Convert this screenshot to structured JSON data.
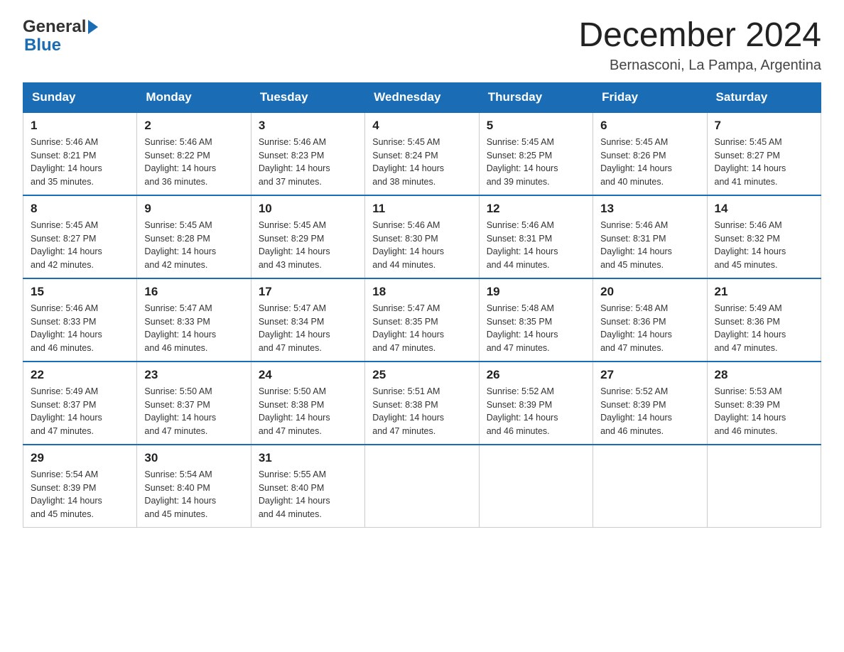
{
  "header": {
    "logo_general": "General",
    "logo_blue": "Blue",
    "title": "December 2024",
    "subtitle": "Bernasconi, La Pampa, Argentina"
  },
  "weekdays": [
    "Sunday",
    "Monday",
    "Tuesday",
    "Wednesday",
    "Thursday",
    "Friday",
    "Saturday"
  ],
  "weeks": [
    [
      {
        "day": "1",
        "sunrise": "5:46 AM",
        "sunset": "8:21 PM",
        "daylight": "14 hours and 35 minutes."
      },
      {
        "day": "2",
        "sunrise": "5:46 AM",
        "sunset": "8:22 PM",
        "daylight": "14 hours and 36 minutes."
      },
      {
        "day": "3",
        "sunrise": "5:46 AM",
        "sunset": "8:23 PM",
        "daylight": "14 hours and 37 minutes."
      },
      {
        "day": "4",
        "sunrise": "5:45 AM",
        "sunset": "8:24 PM",
        "daylight": "14 hours and 38 minutes."
      },
      {
        "day": "5",
        "sunrise": "5:45 AM",
        "sunset": "8:25 PM",
        "daylight": "14 hours and 39 minutes."
      },
      {
        "day": "6",
        "sunrise": "5:45 AM",
        "sunset": "8:26 PM",
        "daylight": "14 hours and 40 minutes."
      },
      {
        "day": "7",
        "sunrise": "5:45 AM",
        "sunset": "8:27 PM",
        "daylight": "14 hours and 41 minutes."
      }
    ],
    [
      {
        "day": "8",
        "sunrise": "5:45 AM",
        "sunset": "8:27 PM",
        "daylight": "14 hours and 42 minutes."
      },
      {
        "day": "9",
        "sunrise": "5:45 AM",
        "sunset": "8:28 PM",
        "daylight": "14 hours and 42 minutes."
      },
      {
        "day": "10",
        "sunrise": "5:45 AM",
        "sunset": "8:29 PM",
        "daylight": "14 hours and 43 minutes."
      },
      {
        "day": "11",
        "sunrise": "5:46 AM",
        "sunset": "8:30 PM",
        "daylight": "14 hours and 44 minutes."
      },
      {
        "day": "12",
        "sunrise": "5:46 AM",
        "sunset": "8:31 PM",
        "daylight": "14 hours and 44 minutes."
      },
      {
        "day": "13",
        "sunrise": "5:46 AM",
        "sunset": "8:31 PM",
        "daylight": "14 hours and 45 minutes."
      },
      {
        "day": "14",
        "sunrise": "5:46 AM",
        "sunset": "8:32 PM",
        "daylight": "14 hours and 45 minutes."
      }
    ],
    [
      {
        "day": "15",
        "sunrise": "5:46 AM",
        "sunset": "8:33 PM",
        "daylight": "14 hours and 46 minutes."
      },
      {
        "day": "16",
        "sunrise": "5:47 AM",
        "sunset": "8:33 PM",
        "daylight": "14 hours and 46 minutes."
      },
      {
        "day": "17",
        "sunrise": "5:47 AM",
        "sunset": "8:34 PM",
        "daylight": "14 hours and 47 minutes."
      },
      {
        "day": "18",
        "sunrise": "5:47 AM",
        "sunset": "8:35 PM",
        "daylight": "14 hours and 47 minutes."
      },
      {
        "day": "19",
        "sunrise": "5:48 AM",
        "sunset": "8:35 PM",
        "daylight": "14 hours and 47 minutes."
      },
      {
        "day": "20",
        "sunrise": "5:48 AM",
        "sunset": "8:36 PM",
        "daylight": "14 hours and 47 minutes."
      },
      {
        "day": "21",
        "sunrise": "5:49 AM",
        "sunset": "8:36 PM",
        "daylight": "14 hours and 47 minutes."
      }
    ],
    [
      {
        "day": "22",
        "sunrise": "5:49 AM",
        "sunset": "8:37 PM",
        "daylight": "14 hours and 47 minutes."
      },
      {
        "day": "23",
        "sunrise": "5:50 AM",
        "sunset": "8:37 PM",
        "daylight": "14 hours and 47 minutes."
      },
      {
        "day": "24",
        "sunrise": "5:50 AM",
        "sunset": "8:38 PM",
        "daylight": "14 hours and 47 minutes."
      },
      {
        "day": "25",
        "sunrise": "5:51 AM",
        "sunset": "8:38 PM",
        "daylight": "14 hours and 47 minutes."
      },
      {
        "day": "26",
        "sunrise": "5:52 AM",
        "sunset": "8:39 PM",
        "daylight": "14 hours and 46 minutes."
      },
      {
        "day": "27",
        "sunrise": "5:52 AM",
        "sunset": "8:39 PM",
        "daylight": "14 hours and 46 minutes."
      },
      {
        "day": "28",
        "sunrise": "5:53 AM",
        "sunset": "8:39 PM",
        "daylight": "14 hours and 46 minutes."
      }
    ],
    [
      {
        "day": "29",
        "sunrise": "5:54 AM",
        "sunset": "8:39 PM",
        "daylight": "14 hours and 45 minutes."
      },
      {
        "day": "30",
        "sunrise": "5:54 AM",
        "sunset": "8:40 PM",
        "daylight": "14 hours and 45 minutes."
      },
      {
        "day": "31",
        "sunrise": "5:55 AM",
        "sunset": "8:40 PM",
        "daylight": "14 hours and 44 minutes."
      },
      null,
      null,
      null,
      null
    ]
  ],
  "labels": {
    "sunrise": "Sunrise:",
    "sunset": "Sunset:",
    "daylight": "Daylight:"
  }
}
